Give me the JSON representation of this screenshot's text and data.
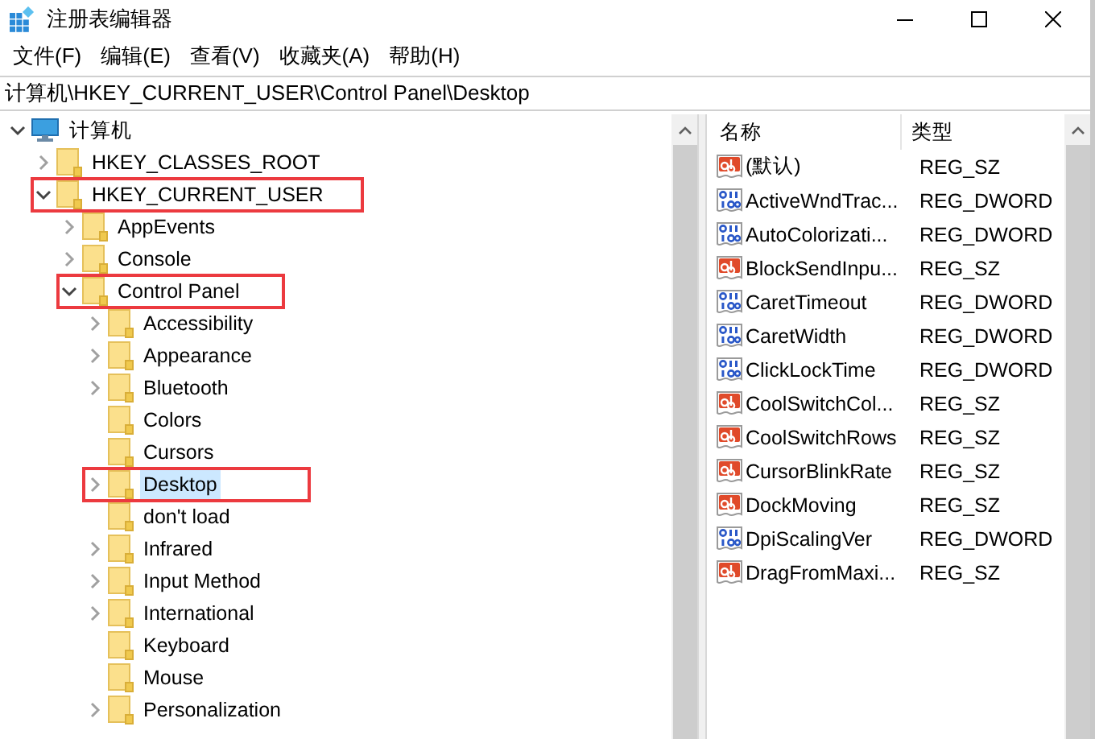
{
  "window": {
    "title": "注册表编辑器"
  },
  "menu": [
    "文件(F)",
    "编辑(E)",
    "查看(V)",
    "收藏夹(A)",
    "帮助(H)"
  ],
  "address": "计算机\\HKEY_CURRENT_USER\\Control Panel\\Desktop",
  "tree": [
    {
      "label": "计算机",
      "kind": "computer",
      "expanded": true,
      "selected": false,
      "highlighted": false,
      "children": [
        {
          "label": "HKEY_CLASSES_ROOT",
          "kind": "folder",
          "expanded": false,
          "selected": false,
          "highlighted": false
        },
        {
          "label": "HKEY_CURRENT_USER",
          "kind": "folder",
          "expanded": true,
          "selected": false,
          "highlighted": true,
          "children": [
            {
              "label": "AppEvents",
              "kind": "folder",
              "expanded": false,
              "selected": false,
              "highlighted": false
            },
            {
              "label": "Console",
              "kind": "folder",
              "expanded": false,
              "selected": false,
              "highlighted": false
            },
            {
              "label": "Control Panel",
              "kind": "folder",
              "expanded": true,
              "selected": false,
              "highlighted": true,
              "children": [
                {
                  "label": "Accessibility",
                  "kind": "folder",
                  "expanded": false,
                  "selected": false,
                  "highlighted": false
                },
                {
                  "label": "Appearance",
                  "kind": "folder",
                  "expanded": false,
                  "selected": false,
                  "highlighted": false
                },
                {
                  "label": "Bluetooth",
                  "kind": "folder",
                  "expanded": false,
                  "selected": false,
                  "highlighted": false
                },
                {
                  "label": "Colors",
                  "kind": "folder",
                  "selected": false,
                  "highlighted": false
                },
                {
                  "label": "Cursors",
                  "kind": "folder",
                  "selected": false,
                  "highlighted": false
                },
                {
                  "label": "Desktop",
                  "kind": "folder",
                  "expanded": false,
                  "selected": true,
                  "highlighted": true
                },
                {
                  "label": "don't load",
                  "kind": "folder",
                  "selected": false,
                  "highlighted": false
                },
                {
                  "label": "Infrared",
                  "kind": "folder",
                  "expanded": false,
                  "selected": false,
                  "highlighted": false
                },
                {
                  "label": "Input Method",
                  "kind": "folder",
                  "expanded": false,
                  "selected": false,
                  "highlighted": false
                },
                {
                  "label": "International",
                  "kind": "folder",
                  "expanded": false,
                  "selected": false,
                  "highlighted": false
                },
                {
                  "label": "Keyboard",
                  "kind": "folder",
                  "selected": false,
                  "highlighted": false
                },
                {
                  "label": "Mouse",
                  "kind": "folder",
                  "selected": false,
                  "highlighted": false
                },
                {
                  "label": "Personalization",
                  "kind": "folder",
                  "expanded": false,
                  "selected": false,
                  "highlighted": false
                }
              ]
            }
          ]
        }
      ]
    }
  ],
  "values": {
    "columns": [
      "名称",
      "类型"
    ],
    "rows": [
      {
        "name": "(默认)",
        "type": "REG_SZ",
        "kind": "string"
      },
      {
        "name": "ActiveWndTrac...",
        "type": "REG_DWORD",
        "kind": "dword"
      },
      {
        "name": "AutoColorizati...",
        "type": "REG_DWORD",
        "kind": "dword"
      },
      {
        "name": "BlockSendInpu...",
        "type": "REG_SZ",
        "kind": "string"
      },
      {
        "name": "CaretTimeout",
        "type": "REG_DWORD",
        "kind": "dword"
      },
      {
        "name": "CaretWidth",
        "type": "REG_DWORD",
        "kind": "dword"
      },
      {
        "name": "ClickLockTime",
        "type": "REG_DWORD",
        "kind": "dword"
      },
      {
        "name": "CoolSwitchCol...",
        "type": "REG_SZ",
        "kind": "string"
      },
      {
        "name": "CoolSwitchRows",
        "type": "REG_SZ",
        "kind": "string"
      },
      {
        "name": "CursorBlinkRate",
        "type": "REG_SZ",
        "kind": "string"
      },
      {
        "name": "DockMoving",
        "type": "REG_SZ",
        "kind": "string"
      },
      {
        "name": "DpiScalingVer",
        "type": "REG_DWORD",
        "kind": "dword"
      },
      {
        "name": "DragFromMaxi...",
        "type": "REG_SZ",
        "kind": "string"
      }
    ]
  }
}
